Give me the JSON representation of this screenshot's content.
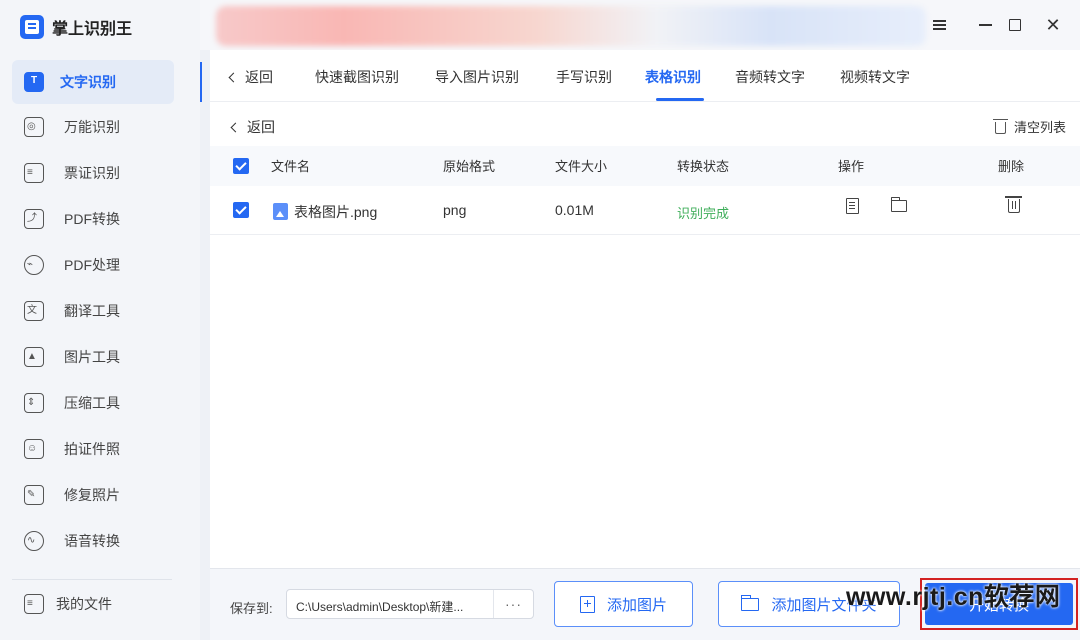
{
  "app": {
    "name": "掌上识别王",
    "brand_color": "#2468f2"
  },
  "sidebar": {
    "items": [
      {
        "label": "文字识别",
        "icon": "text-recognition-icon",
        "active": true
      },
      {
        "label": "万能识别",
        "icon": "universal-scan-icon",
        "active": false
      },
      {
        "label": "票证识别",
        "icon": "ticket-icon",
        "active": false
      },
      {
        "label": "PDF转换",
        "icon": "pdf-convert-icon",
        "active": false
      },
      {
        "label": "PDF处理",
        "icon": "pdf-process-icon",
        "active": false
      },
      {
        "label": "翻译工具",
        "icon": "translate-icon",
        "active": false
      },
      {
        "label": "图片工具",
        "icon": "image-tool-icon",
        "active": false
      },
      {
        "label": "压缩工具",
        "icon": "compress-icon",
        "active": false
      },
      {
        "label": "拍证件照",
        "icon": "id-photo-icon",
        "active": false
      },
      {
        "label": "修复照片",
        "icon": "repair-photo-icon",
        "active": false
      },
      {
        "label": "语音转换",
        "icon": "voice-convert-icon",
        "active": false
      }
    ],
    "my_files": "我的文件"
  },
  "tabs": {
    "back": "返回",
    "items": [
      "快速截图识别",
      "导入图片识别",
      "手写识别",
      "表格识别",
      "音频转文字",
      "视频转文字"
    ],
    "active": "表格识别"
  },
  "toolbar": {
    "back": "返回",
    "clear_list": "清空列表"
  },
  "table": {
    "headers": {
      "name": "文件名",
      "format": "原始格式",
      "size": "文件大小",
      "status": "转换状态",
      "action": "操作",
      "delete": "删除"
    },
    "rows": [
      {
        "name": "表格图片.png",
        "format": "png",
        "size": "0.01M",
        "status": "识别完成",
        "checked": true
      }
    ],
    "status_color": "#3fae5a"
  },
  "bottom": {
    "save_label": "保存到:",
    "save_path": "C:\\Users\\admin\\Desktop\\新建...",
    "more": "···",
    "add_image": "添加图片",
    "add_folder": "添加图片文件夹",
    "start": "开始转换"
  },
  "watermark": "www.rjtj.cn软荐网"
}
